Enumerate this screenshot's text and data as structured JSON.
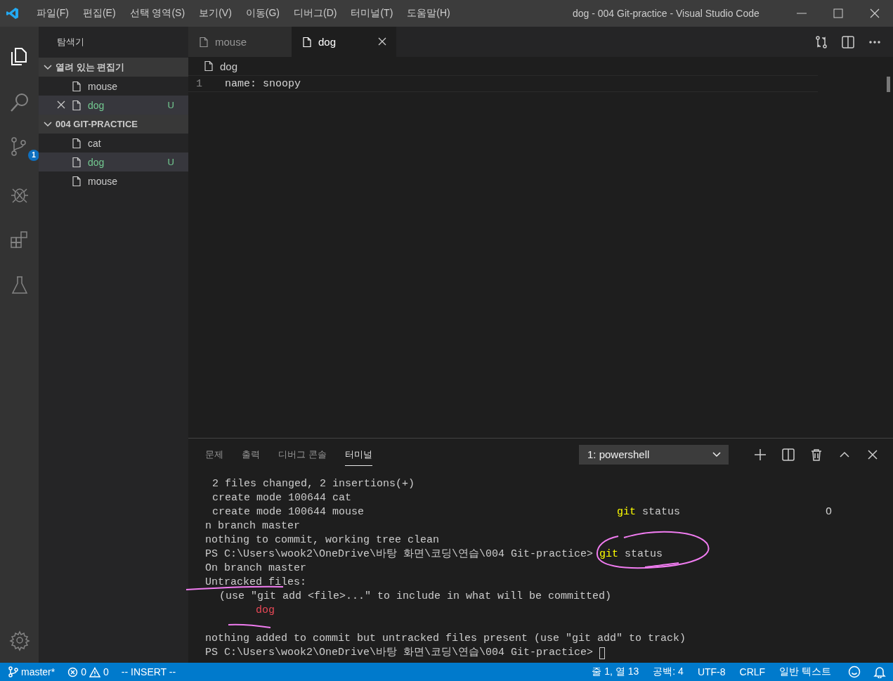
{
  "window": {
    "title": "dog - 004 Git-practice - Visual Studio Code"
  },
  "menu": [
    "파일(F)",
    "편집(E)",
    "선택 영역(S)",
    "보기(V)",
    "이동(G)",
    "디버그(D)",
    "터미널(T)",
    "도움말(H)"
  ],
  "activity_bar": {
    "source_control_badge": "1"
  },
  "sidebar": {
    "title": "탐색기",
    "sections": [
      {
        "title": "열려 있는 편집기",
        "kind": "open_editors",
        "expanded": true,
        "items": [
          {
            "name": "mouse",
            "untracked": false,
            "selected": false
          },
          {
            "name": "dog",
            "untracked": true,
            "badge": "U",
            "selected": true
          }
        ]
      },
      {
        "title": "004 GIT-PRACTICE",
        "kind": "folder",
        "expanded": true,
        "items": [
          {
            "name": "cat",
            "untracked": false,
            "selected": false
          },
          {
            "name": "dog",
            "untracked": true,
            "badge": "U",
            "selected": true
          },
          {
            "name": "mouse",
            "untracked": false,
            "selected": false
          }
        ]
      }
    ]
  },
  "tabs": [
    {
      "label": "mouse",
      "selected": false
    },
    {
      "label": "dog",
      "selected": true
    }
  ],
  "breadcrumb": "dog",
  "editor": {
    "lines": [
      {
        "number": "1",
        "text": "name: snoopy"
      }
    ]
  },
  "panel": {
    "tabs": [
      {
        "label": "문제",
        "selected": false
      },
      {
        "label": "출력",
        "selected": false
      },
      {
        "label": "디버그 콘솔",
        "selected": false
      },
      {
        "label": "터미널",
        "selected": true
      }
    ],
    "terminal_selector": "1: powershell",
    "terminal": [
      {
        "kind": "stat",
        "segments": [
          {
            "text": "2 files changed, 2 insertions(+)"
          }
        ]
      },
      {
        "kind": "stat",
        "segments": [
          {
            "text": "create mode 100644 cat"
          }
        ]
      },
      {
        "kind": "stat",
        "segments": [
          {
            "text": "create mode 100644 mouse"
          },
          {
            "text": "git",
            "kind": "stray_command"
          },
          {
            "text": "status"
          },
          {
            "text": "O",
            "kind": "far"
          }
        ]
      },
      {
        "kind": "plain",
        "segments": [
          {
            "text": "n branch master"
          }
        ]
      },
      {
        "kind": "plain",
        "segments": [
          {
            "text": "nothing to commit, working tree clean"
          }
        ]
      },
      {
        "kind": "plain",
        "segments": [
          {
            "text": "PS C:\\Users\\wook2\\OneDrive\\바탕 화면\\코딩\\연습\\004 Git-practice>"
          },
          {
            "text": "git",
            "kind": "command"
          },
          {
            "text": "status"
          }
        ]
      },
      {
        "kind": "plain",
        "segments": [
          {
            "text": "On branch master"
          }
        ]
      },
      {
        "kind": "plain",
        "segments": [
          {
            "text": "Untracked files:"
          }
        ]
      },
      {
        "kind": "hint",
        "segments": [
          {
            "text": "(use \"git add <file>...\" to include in what will be committed)"
          }
        ]
      },
      {
        "kind": "file",
        "segments": [
          {
            "text": "dog"
          }
        ]
      },
      {
        "kind": "blank"
      },
      {
        "kind": "plain",
        "segments": [
          {
            "text": "nothing added to commit but untracked files present (use \"git add\" to track)"
          }
        ]
      },
      {
        "kind": "prompt",
        "segments": [
          {
            "text": "PS C:\\Users\\wook2\\OneDrive\\바탕 화면\\코딩\\연습\\004 Git-practice>"
          }
        ]
      }
    ]
  },
  "status_bar": {
    "branch": "master*",
    "errors": "0",
    "warnings": "0",
    "mode": "-- INSERT --",
    "position": "줄 1, 열 13",
    "indent": "공백: 4",
    "encoding": "UTF-8",
    "eol": "CRLF",
    "language": "일반 텍스트"
  }
}
